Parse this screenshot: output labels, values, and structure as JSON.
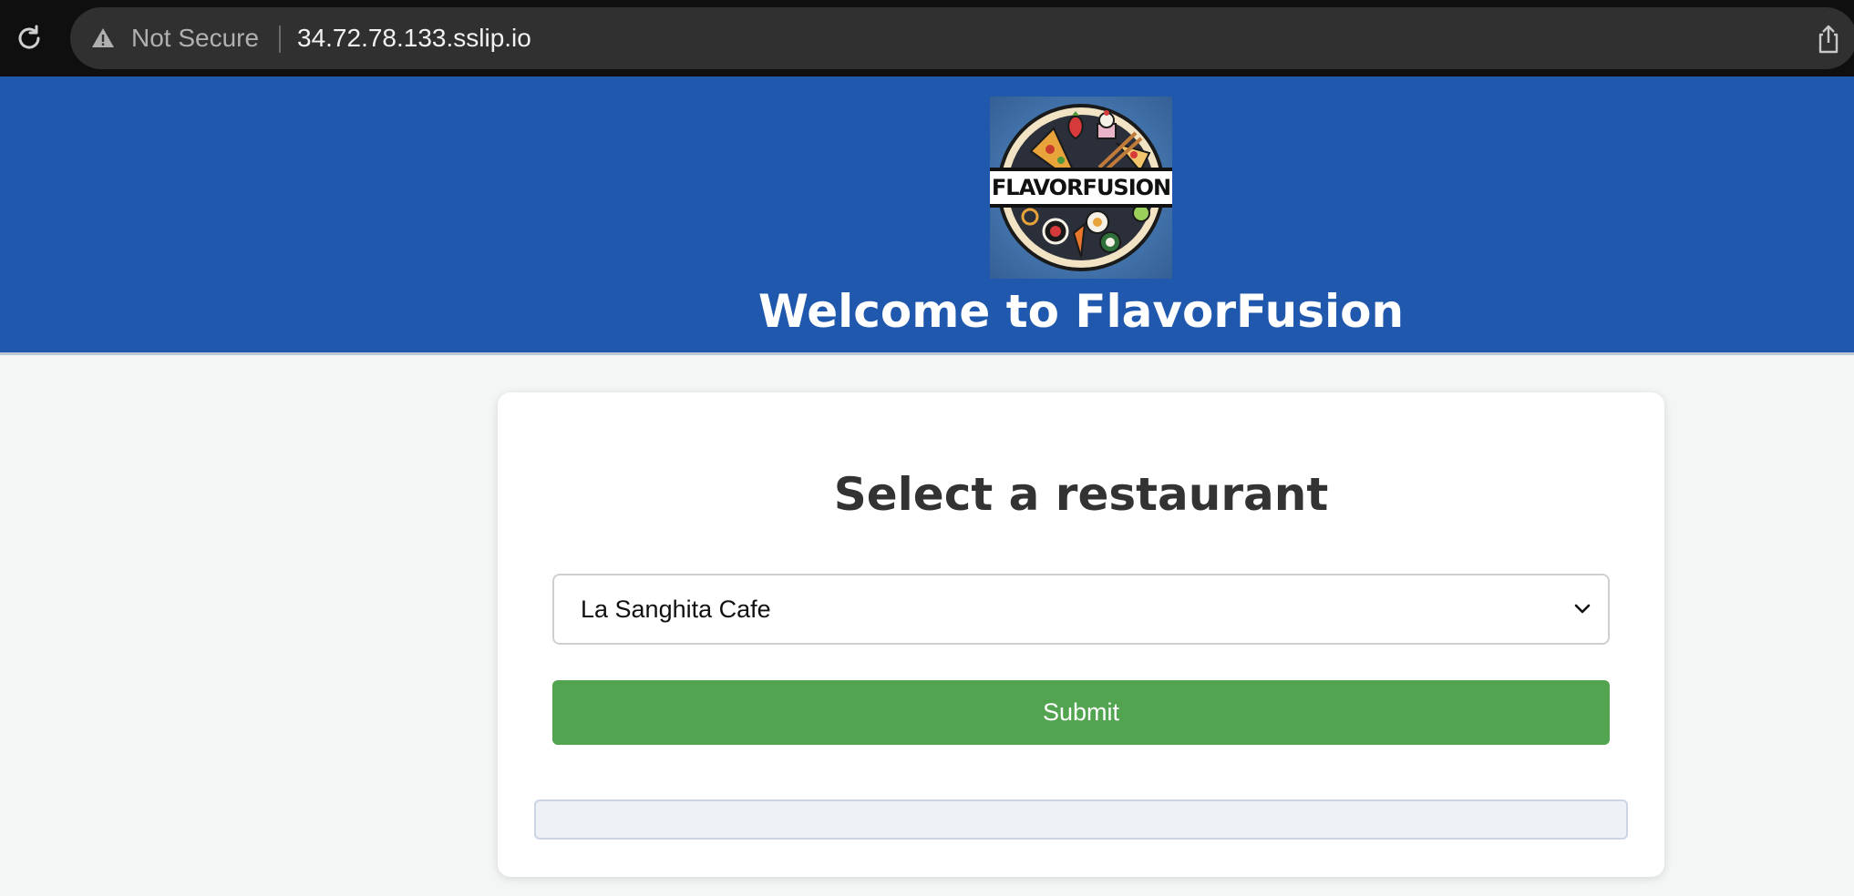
{
  "browser": {
    "security_label": "Not Secure",
    "url": "34.72.78.133.sslip.io",
    "icons": [
      "reload-icon",
      "warning-icon",
      "share-icon",
      "star-icon"
    ]
  },
  "header": {
    "logo_text": "FLAVORFUSION",
    "title": "Welcome to FlavorFusion",
    "background_color": "#1f58ad"
  },
  "main": {
    "title": "Select a restaurant",
    "select": {
      "selected_value": "La Sanghita Cafe"
    },
    "submit_label": "Submit",
    "submit_color": "#53a450",
    "result_text": ""
  }
}
